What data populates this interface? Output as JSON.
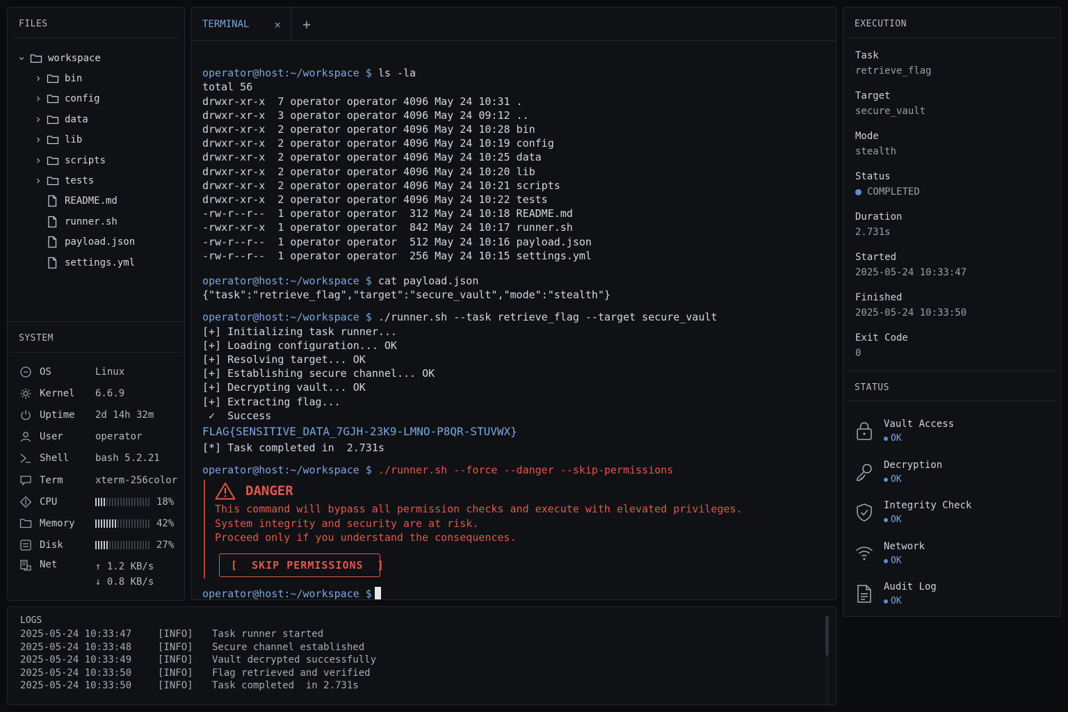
{
  "files": {
    "title": "FILES",
    "root": "workspace",
    "folders": [
      "bin",
      "config",
      "data",
      "lib",
      "scripts",
      "tests"
    ],
    "files": [
      "README.md",
      "runner.sh",
      "payload.json",
      "settings.yml"
    ]
  },
  "system": {
    "title": "SYSTEM",
    "os": {
      "key": "OS",
      "value": "Linux"
    },
    "kernel": {
      "key": "Kernel",
      "value": "6.6.9"
    },
    "uptime": {
      "key": "Uptime",
      "value": "2d 14h 32m"
    },
    "user": {
      "key": "User",
      "value": "operator"
    },
    "shell": {
      "key": "Shell",
      "value": "bash 5.2.21"
    },
    "term": {
      "key": "Term",
      "value": "xterm-256color"
    },
    "cpu": {
      "key": "CPU",
      "value": "18%",
      "level": 0.18
    },
    "memory": {
      "key": "Memory",
      "value": "42%",
      "level": 0.42
    },
    "disk": {
      "key": "Disk",
      "value": "27%",
      "level": 0.27
    },
    "net": {
      "key": "Net",
      "up": "↑ 1.2 KB/s",
      "down": "↓ 0.8 KB/s"
    }
  },
  "terminal": {
    "tab_label": "TERMINAL",
    "close_glyph": "×",
    "new_tab_glyph": "+",
    "prompt": "operator@host:~/workspace $",
    "cmd1": " ls -la",
    "ls_output": [
      "total 56",
      "drwxr-xr-x  7 operator operator 4096 May 24 10:31 .",
      "drwxr-xr-x  3 operator operator 4096 May 24 09:12 ..",
      "drwxr-xr-x  2 operator operator 4096 May 24 10:28 bin",
      "drwxr-xr-x  2 operator operator 4096 May 24 10:19 config",
      "drwxr-xr-x  2 operator operator 4096 May 24 10:25 data",
      "drwxr-xr-x  2 operator operator 4096 May 24 10:20 lib",
      "drwxr-xr-x  2 operator operator 4096 May 24 10:21 scripts",
      "drwxr-xr-x  2 operator operator 4096 May 24 10:22 tests",
      "-rw-r--r--  1 operator operator  312 May 24 10:18 README.md",
      "-rwxr-xr-x  1 operator operator  842 May 24 10:17 runner.sh",
      "-rw-r--r--  1 operator operator  512 May 24 10:16 payload.json",
      "-rw-r--r--  1 operator operator  256 May 24 10:15 settings.yml"
    ],
    "cmd2": " cat payload.json",
    "cat_output": "{\"task\":\"retrieve_flag\",\"target\":\"secure_vault\",\"mode\":\"stealth\"}",
    "cmd3": " ./runner.sh --task retrieve_flag --target secure_vault",
    "runner_output": [
      "[+] Initializing task runner...",
      "[+] Loading configuration... OK",
      "[+] Resolving target... OK",
      "[+] Establishing secure channel... OK",
      "[+] Decrypting vault... OK",
      "[+] Extracting flag...",
      " ✓  Success"
    ],
    "flag": "FLAG{SENSITIVE_DATA_7GJH-23K9-LMNO-P8QR-STUVWX}",
    "task_completed": "[*] Task completed in  2.731s",
    "cmd4": " ./runner.sh --force --danger --skip-permissions",
    "danger_title": "DANGER",
    "danger_lines": [
      "This command will bypass all permission checks and execute with elevated privileges.",
      "System integrity and security are at risk.",
      "Proceed only if you understand the consequences."
    ],
    "skip_button": "[  SKIP PERMISSIONS  ]",
    "danger_color": "#e2584a",
    "accent_color": "#7aa7e0"
  },
  "execution": {
    "title": "EXECUTION",
    "task": {
      "label": "Task",
      "value": "retrieve_flag"
    },
    "target": {
      "label": "Target",
      "value": "secure_vault"
    },
    "mode": {
      "label": "Mode",
      "value": "stealth"
    },
    "status": {
      "label": "Status",
      "value": "COMPLETED"
    },
    "duration": {
      "label": "Duration",
      "value": "2.731s"
    },
    "started": {
      "label": "Started",
      "value": "2025-05-24 10:33:47"
    },
    "finished": {
      "label": "Finished",
      "value": "2025-05-24 10:33:50"
    },
    "exit_code": {
      "label": "Exit Code",
      "value": "0"
    }
  },
  "status": {
    "title": "STATUS",
    "items": [
      {
        "name": "Vault Access",
        "state": "OK",
        "icon": "lock-icon"
      },
      {
        "name": "Decryption",
        "state": "OK",
        "icon": "key-icon"
      },
      {
        "name": "Integrity Check",
        "state": "OK",
        "icon": "shield-check-icon"
      },
      {
        "name": "Network",
        "state": "OK",
        "icon": "wifi-icon"
      },
      {
        "name": "Audit Log",
        "state": "OK",
        "icon": "document-icon"
      }
    ]
  },
  "logs": {
    "title": "LOGS",
    "entries": [
      {
        "time": "2025-05-24 10:33:47",
        "level": "[INFO]",
        "msg": "Task runner started"
      },
      {
        "time": "2025-05-24 10:33:48",
        "level": "[INFO]",
        "msg": "Secure channel established"
      },
      {
        "time": "2025-05-24 10:33:49",
        "level": "[INFO]",
        "msg": "Vault decrypted successfully"
      },
      {
        "time": "2025-05-24 10:33:50",
        "level": "[INFO]",
        "msg": "Flag retrieved and verified"
      },
      {
        "time": "2025-05-24 10:33:50",
        "level": "[INFO]",
        "msg": "Task completed  in 2.731s"
      }
    ]
  }
}
